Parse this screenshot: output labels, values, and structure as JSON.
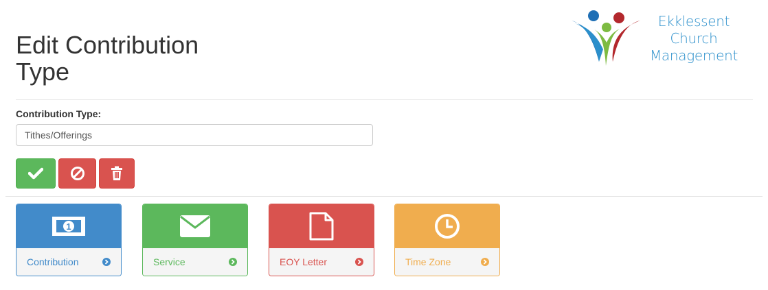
{
  "page": {
    "title": "Edit Contribution Type"
  },
  "logo": {
    "line1": "Ekklessent",
    "line2": "Church",
    "line3": "Management"
  },
  "form": {
    "field_label": "Contribution Type:",
    "field_value": "Tithes/Offerings"
  },
  "actions": [
    {
      "icon": "check-icon",
      "color": "#5cb85c"
    },
    {
      "icon": "ban-icon",
      "color": "#d9534f"
    },
    {
      "icon": "trash-icon",
      "color": "#d9534f"
    }
  ],
  "tiles": [
    {
      "label": "Contribution",
      "icon": "money-icon",
      "color": "#428bca"
    },
    {
      "label": "Service",
      "icon": "envelope-icon",
      "color": "#5cb85c"
    },
    {
      "label": "EOY Letter",
      "icon": "document-icon",
      "color": "#d9534f"
    },
    {
      "label": "Time Zone",
      "icon": "clock-icon",
      "color": "#f0ad4e"
    }
  ]
}
